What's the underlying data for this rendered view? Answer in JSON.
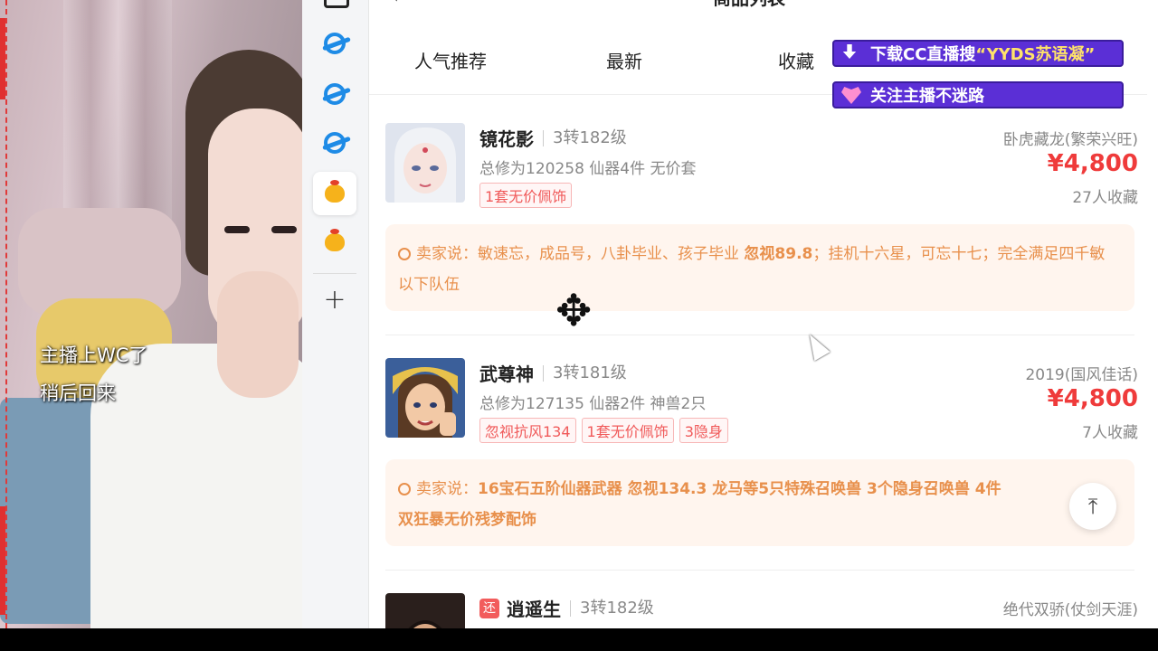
{
  "webcam": {
    "message_line1": "主播上WC了",
    "message_line2": "稍后回来"
  },
  "header": {
    "title": "商品列表"
  },
  "tabs": [
    {
      "label": "人气推荐"
    },
    {
      "label": "最新"
    },
    {
      "label": "收藏"
    }
  ],
  "overlay": {
    "download_prefix": "下载CC直播搜",
    "download_highlight": "“YYDS苏语凝”",
    "follow": "关注主播不迷路"
  },
  "items": [
    {
      "name": "镜花影",
      "level": "3转182级",
      "detail": "总修为120258  仙器4件  无价套",
      "tags": [
        "1套无价佩饰"
      ],
      "server": "卧虎藏龙(繁荣兴旺)",
      "price": "¥4,800",
      "favorites": "27人收藏",
      "seller_prefix": "卖家说：",
      "seller_text": "敏速忘，成品号，八卦毕业、孩子毕业 ",
      "seller_bold": "忽视89.8",
      "seller_text2": "；挂机十六星，可忘十七；完全满足四千敏以下队伍"
    },
    {
      "name": "武尊神",
      "level": "3转181级",
      "detail": "总修为127135  仙器2件  神兽2只",
      "tags": [
        "忽视抗风134",
        "1套无价佩饰",
        "3隐身"
      ],
      "server": "2019(国风佳话)",
      "price": "¥4,800",
      "favorites": "7人收藏",
      "seller_prefix": "卖家说：",
      "seller_bold": "16宝石五阶仙器武器 忽视134.3 龙马等5只特殊召唤兽 3个隐身召唤兽 4件",
      "seller_bold2": "双狂暴无价残梦配饰"
    },
    {
      "badge": "还",
      "name": "逍遥生",
      "level": "3转182级",
      "server": "绝代双骄(仗剑天涯)"
    }
  ]
}
